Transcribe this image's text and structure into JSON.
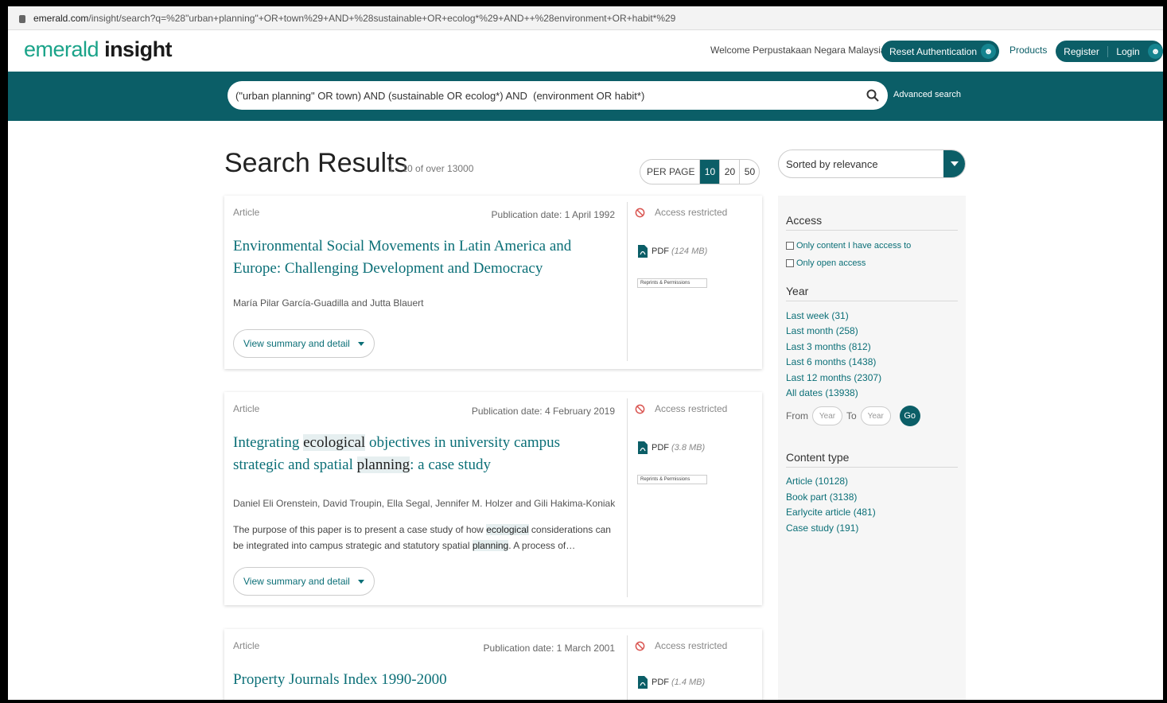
{
  "browser": {
    "url_domain": "emerald.com",
    "url_path": "/insight/search?q=%28\"urban+planning\"+OR+town%29+AND+%28sustainable+OR+ecolog*%29+AND++%28environment+OR+habit*%29"
  },
  "header": {
    "logo_part1": "emerald",
    "logo_part2": "insight",
    "welcome": "Welcome Perpustakaan Negara Malaysia",
    "reset_auth": "Reset Authentication",
    "products": "Products",
    "register": "Register",
    "login": "Login"
  },
  "search": {
    "query": "(\"urban planning\" OR town) AND (sustainable OR ecolog*) AND  (environment OR habit*)",
    "advanced": "Advanced search"
  },
  "results": {
    "title": "Search Results",
    "count": "1 - 10 of over 13000",
    "per_page_label": "PER PAGE",
    "per_page_options": [
      "10",
      "20",
      "50"
    ],
    "per_page_selected": "10",
    "sort_label": "Sorted by relevance"
  },
  "cards": [
    {
      "kind": "Article",
      "pubdate": "Publication date: 1 April 1992",
      "title": "Environmental Social Movements in Latin America and Europe: Challenging Development and Democracy",
      "authors": "María Pilar García-Guadilla and Jutta Blauert",
      "view_summary": "View summary and detail",
      "access": "Access restricted",
      "pdf_label": "PDF",
      "pdf_size": "(124 MB)",
      "reprints": "Reprints & Permissions"
    },
    {
      "kind": "Article",
      "pubdate": "Publication date: 4 February 2019",
      "title_parts": [
        "Integrating ",
        "ecological",
        " objectives in university campus strategic and spatial ",
        "planning",
        ": a case study"
      ],
      "authors": "Daniel Eli Orenstein, David Troupin, Ella Segal, Jennifer M. Holzer and Gili Hakima-Koniak",
      "abstract_parts": [
        "The purpose of this paper is to present a case study of how ",
        "ecological",
        " considerations can be integrated into campus strategic and statutory spatial ",
        "planning",
        ". A process of…"
      ],
      "view_summary": "View summary and detail",
      "access": "Access restricted",
      "pdf_label": "PDF",
      "pdf_size": "(3.8 MB)",
      "reprints": "Reprints & Permissions"
    },
    {
      "kind": "Article",
      "pubdate": "Publication date: 1 March 2001",
      "title": "Property Journals Index 1990-2000",
      "access": "Access restricted",
      "pdf_label": "PDF",
      "pdf_size": "(1.4 MB)"
    }
  ],
  "sidebar": {
    "access_heading": "Access",
    "access_options": [
      "Only content I have access to",
      "Only open access"
    ],
    "year_heading": "Year",
    "year_links": [
      "Last week (31)",
      "Last month (258)",
      "Last 3 months (812)",
      "Last 6 months (1438)",
      "Last 12 months (2307)",
      "All dates (13938)"
    ],
    "from_label": "From",
    "to_label": "To",
    "year_placeholder": "Year",
    "go": "Go",
    "content_heading": "Content type",
    "content_links": [
      "Article (10128)",
      "Book part (3138)",
      "Earlycite article (481)",
      "Case study (191)"
    ]
  },
  "colors": {
    "brand": "#0b5e67",
    "link": "#0b6f77",
    "logo_green": "#1aa389"
  }
}
